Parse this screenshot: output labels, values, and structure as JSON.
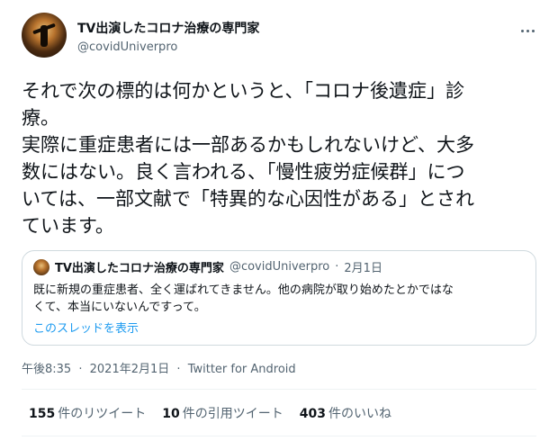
{
  "author": {
    "display_name": "TV出演したコロナ治療の専門家",
    "handle": "@covidUniverpro"
  },
  "tweet": {
    "lines": [
      "それで次の標的は何かというと、「コロナ後遺症」診",
      "療。",
      "実際に重症患者には一部あるかもしれないけど、大多",
      "数にはない。良く言われる、「慢性疲労症候群」につ",
      "いては、一部文献で「特異的な心因性がある」とされ",
      "ています。"
    ]
  },
  "quoted": {
    "display_name": "TV出演したコロナ治療の専門家",
    "handle": "@covidUniverpro",
    "separator": "·",
    "date": "2月1日",
    "lines": [
      "既に新規の重症患者、全く運ばれてきません。他の病院が取り始めたとかではな",
      "くて、本当にいないんですって。"
    ],
    "thread_link": "このスレッドを表示"
  },
  "meta": {
    "time": "午後8:35",
    "date": "2021年2月1日",
    "source": "Twitter for Android",
    "separator": "·"
  },
  "stats": {
    "retweets_count": "155",
    "retweets_label": "件のリツイート",
    "quotes_count": "10",
    "quotes_label": "件の引用ツイート",
    "likes_count": "403",
    "likes_label": "件のいいね"
  },
  "colors": {
    "text": "#0f1419",
    "secondary": "#536471",
    "link": "#1d9bf0",
    "border": "#cfd9de"
  }
}
